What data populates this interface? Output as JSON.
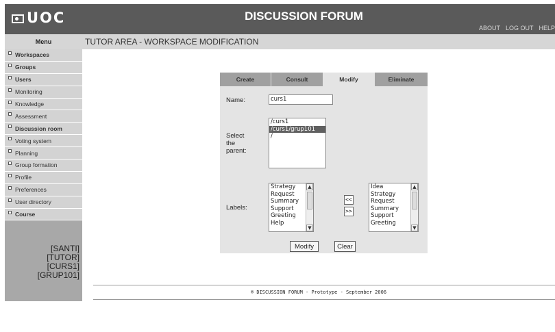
{
  "header": {
    "logo": "UOC",
    "title": "DISCUSSION FORUM",
    "links": [
      "ABOUT",
      "LOG OUT",
      "HELP"
    ]
  },
  "sidebar": {
    "menu_title": "Menu",
    "items": [
      {
        "label": "Workspaces",
        "bold": true
      },
      {
        "label": "Groups",
        "bold": true
      },
      {
        "label": "Users",
        "bold": true
      },
      {
        "label": "Monitoring",
        "bold": false
      },
      {
        "label": "Knowledge",
        "bold": false
      },
      {
        "label": "Assessment",
        "bold": false
      },
      {
        "label": "Discussion room",
        "bold": true
      },
      {
        "label": "Voting system",
        "bold": false
      },
      {
        "label": "Planning",
        "bold": false
      },
      {
        "label": "Group formation",
        "bold": false
      },
      {
        "label": "Profile",
        "bold": false
      },
      {
        "label": "Preferences",
        "bold": false
      },
      {
        "label": "User directory",
        "bold": false
      },
      {
        "label": "Course",
        "bold": true
      }
    ],
    "user_info": [
      "[SANTI]",
      "[TUTOR]",
      "[CURS1]",
      "[GRUP101]"
    ]
  },
  "area_title": "TUTOR AREA - WORKSPACE MODIFICATION",
  "tabs": [
    "Create",
    "Consult",
    "Modify",
    "Eliminate"
  ],
  "active_tab": "Modify",
  "form": {
    "name_label": "Name:",
    "name_value": "curs1",
    "parent_label_lines": [
      "Select",
      "the",
      "parent:"
    ],
    "parent_options": [
      "/curs1",
      "/curs1/grup101",
      "/"
    ],
    "parent_selected": "/curs1/grup101",
    "labels_label": "Labels:",
    "labels_available": [
      "Strategy",
      "Request",
      "Summary",
      "Support",
      "Greeting",
      "Help"
    ],
    "labels_selected": [
      "Idea",
      "Strategy",
      "Request",
      "Summary",
      "Support",
      "Greeting"
    ],
    "move_left": "<<",
    "move_right": ">>",
    "modify_button": "Modify",
    "clear_button": "Clear"
  },
  "footer": "® DISCUSSION FORUM - Prototype - September 2006"
}
